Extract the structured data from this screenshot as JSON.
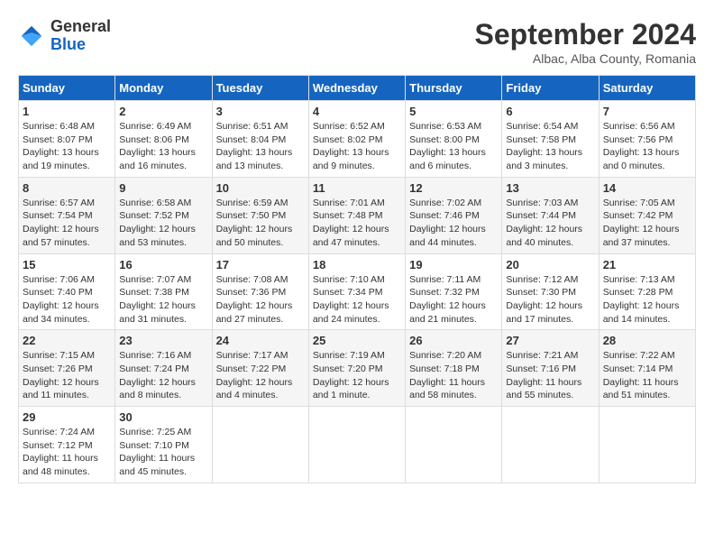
{
  "header": {
    "logo_general": "General",
    "logo_blue": "Blue",
    "month_year": "September 2024",
    "location": "Albac, Alba County, Romania"
  },
  "days_of_week": [
    "Sunday",
    "Monday",
    "Tuesday",
    "Wednesday",
    "Thursday",
    "Friday",
    "Saturday"
  ],
  "weeks": [
    [
      {
        "day": "1",
        "info": "Sunrise: 6:48 AM\nSunset: 8:07 PM\nDaylight: 13 hours\nand 19 minutes."
      },
      {
        "day": "2",
        "info": "Sunrise: 6:49 AM\nSunset: 8:06 PM\nDaylight: 13 hours\nand 16 minutes."
      },
      {
        "day": "3",
        "info": "Sunrise: 6:51 AM\nSunset: 8:04 PM\nDaylight: 13 hours\nand 13 minutes."
      },
      {
        "day": "4",
        "info": "Sunrise: 6:52 AM\nSunset: 8:02 PM\nDaylight: 13 hours\nand 9 minutes."
      },
      {
        "day": "5",
        "info": "Sunrise: 6:53 AM\nSunset: 8:00 PM\nDaylight: 13 hours\nand 6 minutes."
      },
      {
        "day": "6",
        "info": "Sunrise: 6:54 AM\nSunset: 7:58 PM\nDaylight: 13 hours\nand 3 minutes."
      },
      {
        "day": "7",
        "info": "Sunrise: 6:56 AM\nSunset: 7:56 PM\nDaylight: 13 hours\nand 0 minutes."
      }
    ],
    [
      {
        "day": "8",
        "info": "Sunrise: 6:57 AM\nSunset: 7:54 PM\nDaylight: 12 hours\nand 57 minutes."
      },
      {
        "day": "9",
        "info": "Sunrise: 6:58 AM\nSunset: 7:52 PM\nDaylight: 12 hours\nand 53 minutes."
      },
      {
        "day": "10",
        "info": "Sunrise: 6:59 AM\nSunset: 7:50 PM\nDaylight: 12 hours\nand 50 minutes."
      },
      {
        "day": "11",
        "info": "Sunrise: 7:01 AM\nSunset: 7:48 PM\nDaylight: 12 hours\nand 47 minutes."
      },
      {
        "day": "12",
        "info": "Sunrise: 7:02 AM\nSunset: 7:46 PM\nDaylight: 12 hours\nand 44 minutes."
      },
      {
        "day": "13",
        "info": "Sunrise: 7:03 AM\nSunset: 7:44 PM\nDaylight: 12 hours\nand 40 minutes."
      },
      {
        "day": "14",
        "info": "Sunrise: 7:05 AM\nSunset: 7:42 PM\nDaylight: 12 hours\nand 37 minutes."
      }
    ],
    [
      {
        "day": "15",
        "info": "Sunrise: 7:06 AM\nSunset: 7:40 PM\nDaylight: 12 hours\nand 34 minutes."
      },
      {
        "day": "16",
        "info": "Sunrise: 7:07 AM\nSunset: 7:38 PM\nDaylight: 12 hours\nand 31 minutes."
      },
      {
        "day": "17",
        "info": "Sunrise: 7:08 AM\nSunset: 7:36 PM\nDaylight: 12 hours\nand 27 minutes."
      },
      {
        "day": "18",
        "info": "Sunrise: 7:10 AM\nSunset: 7:34 PM\nDaylight: 12 hours\nand 24 minutes."
      },
      {
        "day": "19",
        "info": "Sunrise: 7:11 AM\nSunset: 7:32 PM\nDaylight: 12 hours\nand 21 minutes."
      },
      {
        "day": "20",
        "info": "Sunrise: 7:12 AM\nSunset: 7:30 PM\nDaylight: 12 hours\nand 17 minutes."
      },
      {
        "day": "21",
        "info": "Sunrise: 7:13 AM\nSunset: 7:28 PM\nDaylight: 12 hours\nand 14 minutes."
      }
    ],
    [
      {
        "day": "22",
        "info": "Sunrise: 7:15 AM\nSunset: 7:26 PM\nDaylight: 12 hours\nand 11 minutes."
      },
      {
        "day": "23",
        "info": "Sunrise: 7:16 AM\nSunset: 7:24 PM\nDaylight: 12 hours\nand 8 minutes."
      },
      {
        "day": "24",
        "info": "Sunrise: 7:17 AM\nSunset: 7:22 PM\nDaylight: 12 hours\nand 4 minutes."
      },
      {
        "day": "25",
        "info": "Sunrise: 7:19 AM\nSunset: 7:20 PM\nDaylight: 12 hours\nand 1 minute."
      },
      {
        "day": "26",
        "info": "Sunrise: 7:20 AM\nSunset: 7:18 PM\nDaylight: 11 hours\nand 58 minutes."
      },
      {
        "day": "27",
        "info": "Sunrise: 7:21 AM\nSunset: 7:16 PM\nDaylight: 11 hours\nand 55 minutes."
      },
      {
        "day": "28",
        "info": "Sunrise: 7:22 AM\nSunset: 7:14 PM\nDaylight: 11 hours\nand 51 minutes."
      }
    ],
    [
      {
        "day": "29",
        "info": "Sunrise: 7:24 AM\nSunset: 7:12 PM\nDaylight: 11 hours\nand 48 minutes."
      },
      {
        "day": "30",
        "info": "Sunrise: 7:25 AM\nSunset: 7:10 PM\nDaylight: 11 hours\nand 45 minutes."
      },
      {
        "day": "",
        "info": ""
      },
      {
        "day": "",
        "info": ""
      },
      {
        "day": "",
        "info": ""
      },
      {
        "day": "",
        "info": ""
      },
      {
        "day": "",
        "info": ""
      }
    ]
  ]
}
